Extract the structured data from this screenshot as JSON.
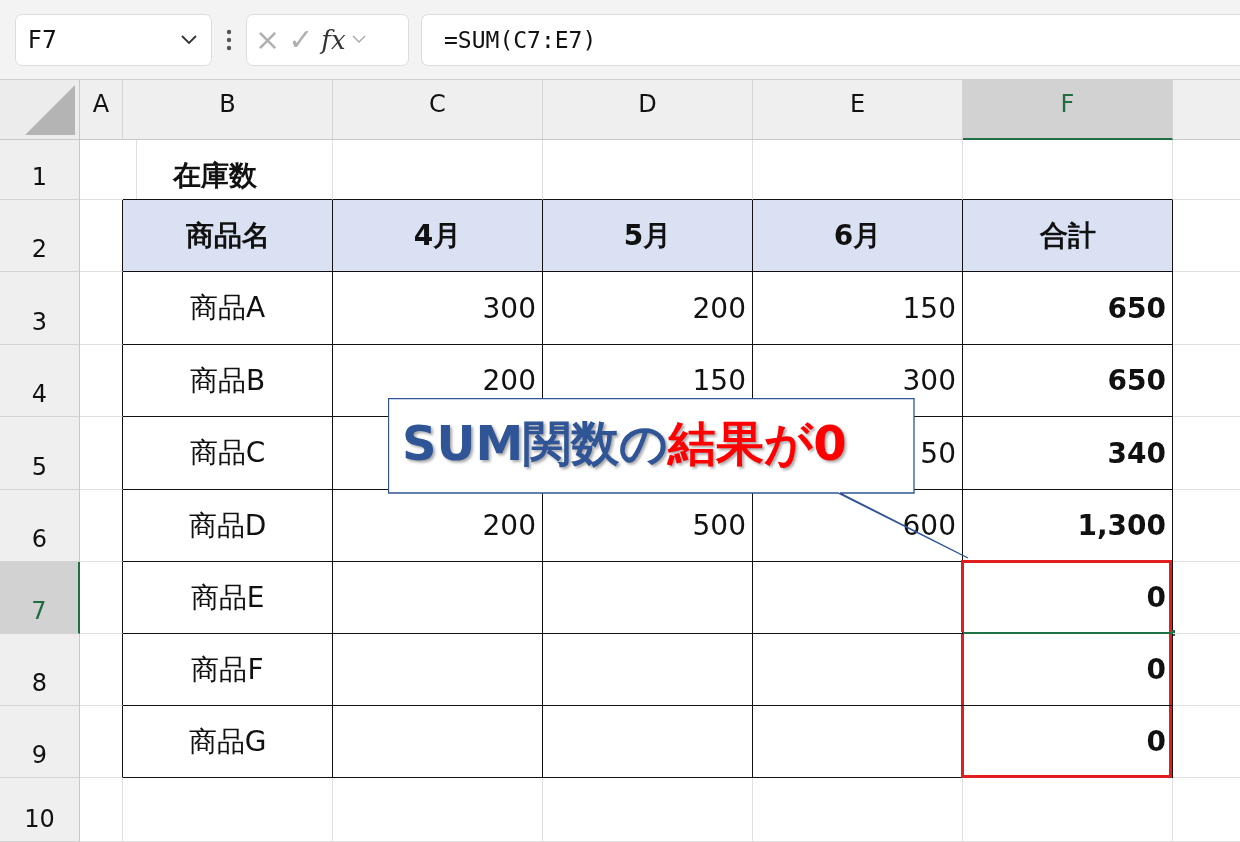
{
  "name_box": {
    "value": "F7"
  },
  "formula_bar": {
    "cancel": "×",
    "enter": "✓",
    "fx": "fx",
    "value": "=SUM(C7:E7)"
  },
  "columns": [
    {
      "label": "A",
      "selected": false
    },
    {
      "label": "B",
      "selected": false
    },
    {
      "label": "C",
      "selected": false
    },
    {
      "label": "D",
      "selected": false
    },
    {
      "label": "E",
      "selected": false
    },
    {
      "label": "F",
      "selected": true
    }
  ],
  "rows": [
    {
      "number": "1",
      "kind": "title",
      "selected": false,
      "in_outline": false,
      "cells": [
        null,
        "在庫数",
        null,
        null,
        null,
        null
      ]
    },
    {
      "number": "2",
      "kind": "header",
      "selected": false,
      "in_outline": false,
      "cells": [
        null,
        "商品名",
        "4月",
        "5月",
        "6月",
        "合計"
      ]
    },
    {
      "number": "3",
      "kind": "data",
      "selected": false,
      "in_outline": false,
      "cells": [
        null,
        "商品A",
        "300",
        "200",
        "150",
        "650"
      ]
    },
    {
      "number": "4",
      "kind": "data",
      "selected": false,
      "in_outline": false,
      "cells": [
        null,
        "商品B",
        "200",
        "150",
        "300",
        "650"
      ]
    },
    {
      "number": "5",
      "kind": "data",
      "selected": false,
      "in_outline": false,
      "cells": [
        null,
        "商品C",
        null,
        null,
        "50",
        "340"
      ]
    },
    {
      "number": "6",
      "kind": "data",
      "selected": false,
      "in_outline": false,
      "cells": [
        null,
        "商品D",
        "200",
        "500",
        "600",
        "1,300"
      ]
    },
    {
      "number": "7",
      "kind": "data",
      "selected": true,
      "in_outline": true,
      "cells": [
        null,
        "商品E",
        null,
        null,
        null,
        "0"
      ]
    },
    {
      "number": "8",
      "kind": "data",
      "selected": false,
      "in_outline": true,
      "cells": [
        null,
        "商品F",
        null,
        null,
        null,
        "0"
      ]
    },
    {
      "number": "9",
      "kind": "data",
      "selected": false,
      "in_outline": true,
      "cells": [
        null,
        "商品G",
        null,
        null,
        null,
        "0"
      ]
    },
    {
      "number": "10",
      "kind": "empty",
      "selected": false,
      "in_outline": false,
      "cells": [
        null,
        null,
        null,
        null,
        null,
        null
      ]
    }
  ],
  "callout": {
    "parts": [
      {
        "text": "SUM関数の",
        "color": "#2f5597"
      },
      {
        "text": "結果が0",
        "color": "#ff0000"
      }
    ]
  }
}
